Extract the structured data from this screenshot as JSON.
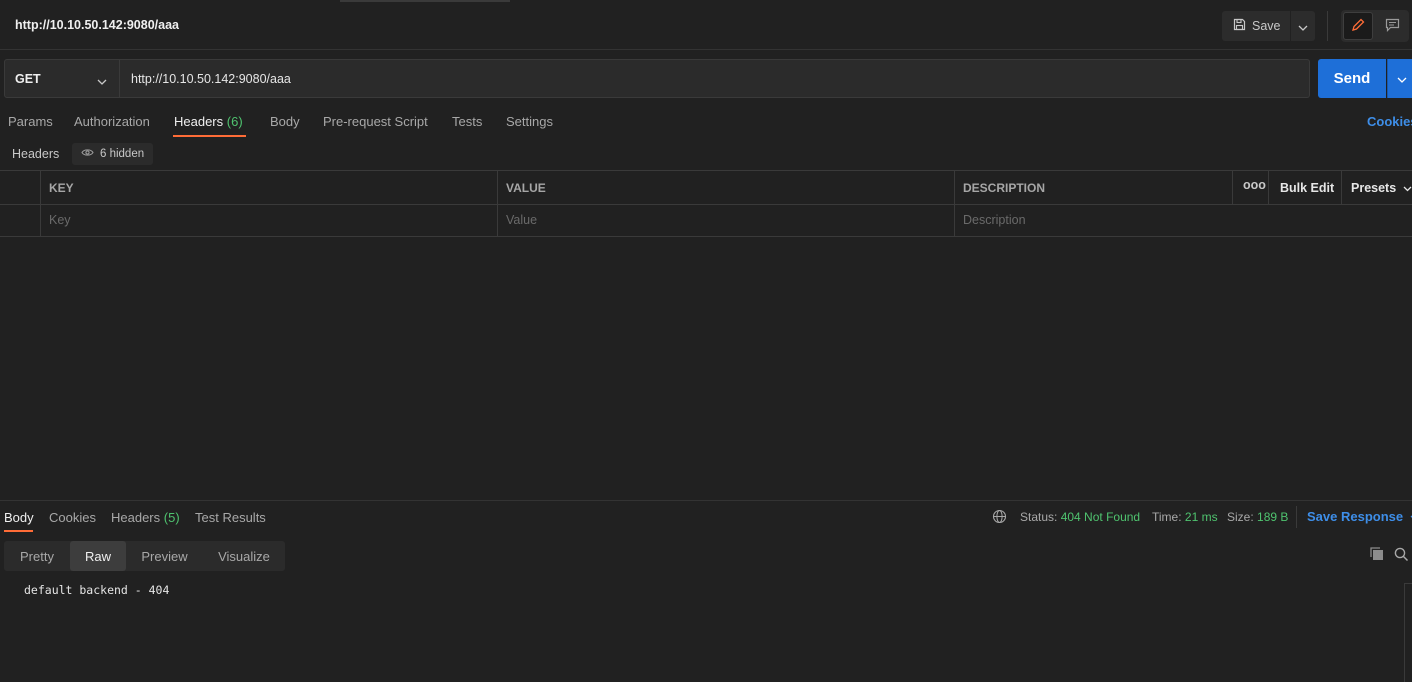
{
  "request": {
    "title": "http://10.10.50.142:9080/aaa",
    "method": "GET",
    "url": "http://10.10.50.142:9080/aaa",
    "save_label": "Save",
    "send_label": "Send"
  },
  "request_tabs": [
    {
      "label": "Params"
    },
    {
      "label": "Authorization"
    },
    {
      "label": "Headers",
      "count": "(6)"
    },
    {
      "label": "Body"
    },
    {
      "label": "Pre-request Script"
    },
    {
      "label": "Tests"
    },
    {
      "label": "Settings"
    }
  ],
  "active_request_tab": "Headers",
  "cookies_label": "Cookies",
  "headers_section": {
    "title": "Headers",
    "hidden_label": "6 hidden",
    "columns": {
      "key": "KEY",
      "value": "VALUE",
      "description": "DESCRIPTION"
    },
    "more_label": "ooo",
    "bulk_edit_label": "Bulk Edit",
    "presets_label": "Presets",
    "placeholders": {
      "key": "Key",
      "value": "Value",
      "description": "Description"
    }
  },
  "response": {
    "tabs": [
      {
        "label": "Body"
      },
      {
        "label": "Cookies"
      },
      {
        "label": "Headers",
        "count": "(5)"
      },
      {
        "label": "Test Results"
      }
    ],
    "active_tab": "Body",
    "status_label": "Status:",
    "status_value": "404 Not Found",
    "time_label": "Time:",
    "time_value": "21 ms",
    "size_label": "Size:",
    "size_value": "189 B",
    "save_response_label": "Save Response",
    "view_modes": [
      "Pretty",
      "Raw",
      "Preview",
      "Visualize"
    ],
    "active_view_mode": "Raw",
    "body_text": "default backend - 404"
  },
  "colors": {
    "accent_orange": "#ff6c37",
    "send_blue": "#1e6fd8",
    "link_blue": "#3e8ee8",
    "status_green": "#4fc36f",
    "background": "#212121"
  },
  "icons": [
    "save-icon",
    "chevron-down-icon",
    "pencil-icon",
    "comment-icon",
    "eye-icon",
    "globe-icon",
    "copy-icon",
    "search-icon"
  ]
}
